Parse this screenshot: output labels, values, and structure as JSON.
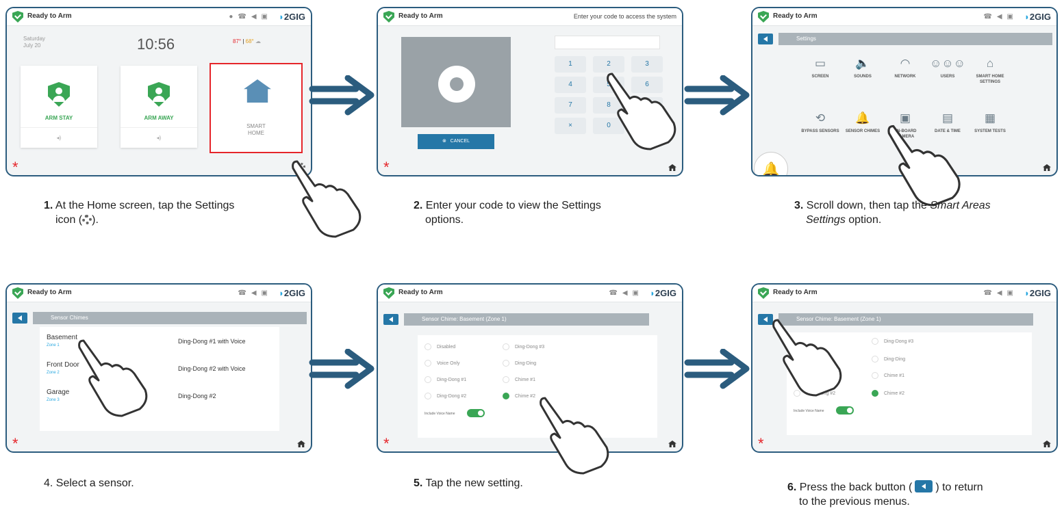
{
  "status": {
    "ready": "Ready to Arm",
    "brand": "2GIG"
  },
  "p1": {
    "day": "Saturday",
    "date": "July 20",
    "time": "10:56",
    "hi": "87°",
    "lo": "68°",
    "stay": "ARM STAY",
    "away": "ARM AWAY",
    "smart1": "SMART",
    "smart2": "HOME"
  },
  "p2": {
    "header": "Enter your code to access the system",
    "cancel": "CANCEL",
    "keys": [
      "1",
      "2",
      "3",
      "4",
      "5",
      "6",
      "7",
      "8",
      "9",
      "×",
      "0",
      ""
    ]
  },
  "p3": {
    "title": "Settings",
    "icons": [
      {
        "glyph": "▭",
        "label": "SCREEN"
      },
      {
        "glyph": "🔈",
        "label": "SOUNDS"
      },
      {
        "glyph": "◠",
        "label": "NETWORK"
      },
      {
        "glyph": "☺☺☺",
        "label": "USERS"
      },
      {
        "glyph": "⌂",
        "label": "SMART HOME SETTINGS"
      },
      {
        "glyph": "⟲",
        "label": "BYPASS SENSORS"
      },
      {
        "glyph": "🔔",
        "label": "SENSOR CHIMES"
      },
      {
        "glyph": "▣",
        "label": "ON-BOARD CAMERA"
      },
      {
        "glyph": "▤",
        "label": "DATE & TIME"
      },
      {
        "glyph": "▦",
        "label": "SYSTEM TESTS"
      }
    ]
  },
  "p4": {
    "title": "Sensor Chimes",
    "rows": [
      {
        "name": "Basement",
        "zone": "Zone 1",
        "chime": "Ding-Dong #1 with Voice"
      },
      {
        "name": "Front Door",
        "zone": "Zone 2",
        "chime": "Ding-Dong #2 with Voice"
      },
      {
        "name": "Garage",
        "zone": "Zone 3",
        "chime": "Ding-Dong #2"
      }
    ]
  },
  "p5": {
    "title": "Sensor Chime: Basement (Zone 1)",
    "left": [
      "Disabled",
      "Voice Only",
      "Ding-Dong #1",
      "Ding-Dong #2"
    ],
    "right": [
      "Ding-Dong #3",
      "Ding-Ding",
      "Chime #1",
      "Chime #2"
    ],
    "voice": "Include Voice Name"
  },
  "p6": {
    "title": "Sensor Chime: Basement (Zone 1)",
    "left": [
      "Ding-Dong #1",
      "Ding-Dong #2"
    ],
    "right": [
      "Ding-Dong #3",
      "Ding-Ding",
      "Chime #1",
      "Chime #2"
    ],
    "voice": "Include Voice Name"
  },
  "captions": {
    "c1n": "1.",
    "c1": " At the Home screen, tap the Settings",
    "c1b": "icon (",
    "c1c": ").",
    "c2n": "2.",
    "c2": " Enter your code to view the Settings",
    "c2b": "options.",
    "c3n": "3.",
    "c3": " Scroll down, then tap the ",
    "c3i": "Smart Areas",
    "c3b": "Settings",
    "c3c": " option.",
    "c4": "4.   Select a sensor.",
    "c5n": "5.",
    "c5": " Tap the new setting.",
    "c6n": "6.",
    "c6": " Press the back button (",
    "c6b": ") to return",
    "c6c": "to the previous menus."
  }
}
